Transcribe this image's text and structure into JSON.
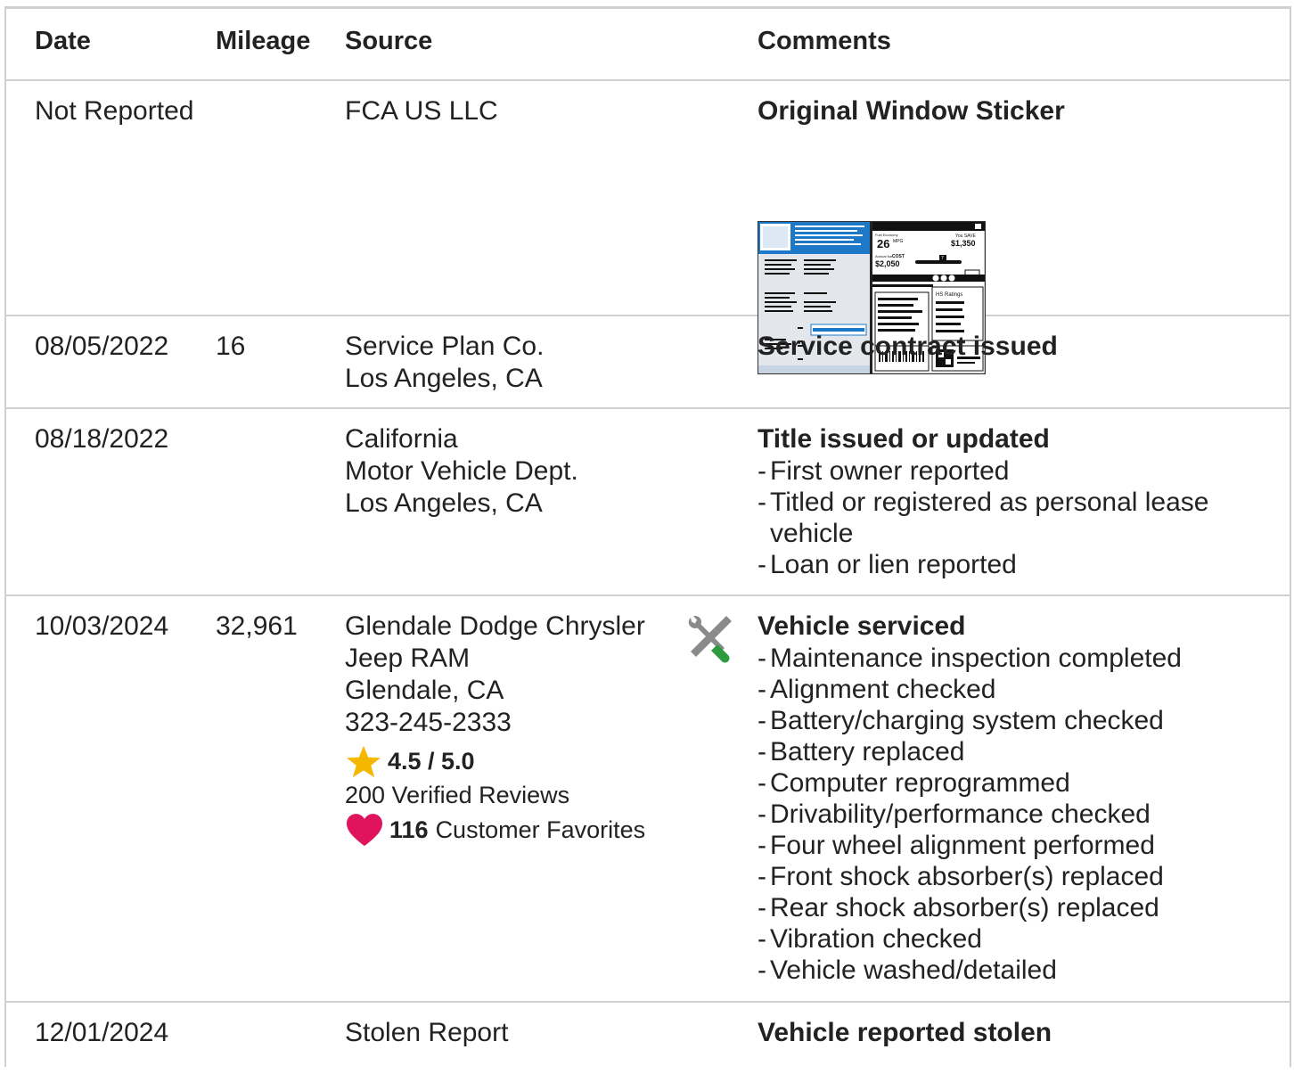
{
  "headers": {
    "date": "Date",
    "mileage": "Mileage",
    "source": "Source",
    "comments": "Comments"
  },
  "records": [
    {
      "date": "Not Reported",
      "mileage": "",
      "source": [
        "FCA US LLC"
      ],
      "comment_title": "Original Window Sticker",
      "sticker": {
        "economy_label": "Fuel Economy",
        "mpg_value": "26",
        "mpg_unit": "MPG",
        "save_label": "You SAVE",
        "save_amount": "$1,350",
        "annual_label": "Annual fuel",
        "cost_word": "COST",
        "annual_cost": "$2,050",
        "scale_marker": "7",
        "safety_title": "HS Ratings"
      }
    },
    {
      "date": "08/05/2022",
      "mileage": "16",
      "source": [
        "Service Plan Co.",
        "Los Angeles, CA"
      ],
      "comment_title": "Service contract issued",
      "details": []
    },
    {
      "date": "08/18/2022",
      "mileage": "",
      "source": [
        "California",
        "Motor Vehicle Dept.",
        "Los Angeles, CA"
      ],
      "comment_title": "Title issued or updated",
      "details": [
        "First owner reported",
        "Titled or registered as personal lease vehicle",
        "Loan or lien reported"
      ]
    },
    {
      "date": "10/03/2024",
      "mileage": "32,961",
      "source": [
        "Glendale Dodge Chrysler",
        "Jeep RAM",
        "Glendale, CA",
        "323-245-2333"
      ],
      "rating": "4.5 / 5.0",
      "reviews": "200 Verified Reviews",
      "favorites_count": "116",
      "favorites_label": "Customer Favorites",
      "icon": "wrench-screwdriver-icon",
      "comment_title": "Vehicle serviced",
      "details": [
        "Maintenance inspection completed",
        "Alignment checked",
        "Battery/charging system checked",
        "Battery replaced",
        "Computer reprogrammed",
        "Drivability/performance checked",
        "Four wheel alignment performed",
        "Front shock absorber(s) replaced",
        "Rear shock absorber(s) replaced",
        "Vibration checked",
        "Vehicle washed/detailed"
      ]
    },
    {
      "date": "12/01/2024",
      "mileage": "",
      "source": [
        "Stolen Report"
      ],
      "comment_title": "Vehicle reported stolen",
      "details": []
    }
  ],
  "colors": {
    "border": "#cfcfcf",
    "star": "#f5b800",
    "heart": "#e0145c",
    "wrench_green": "#2e9a3e",
    "sticker_blue": "#1e78c8"
  }
}
